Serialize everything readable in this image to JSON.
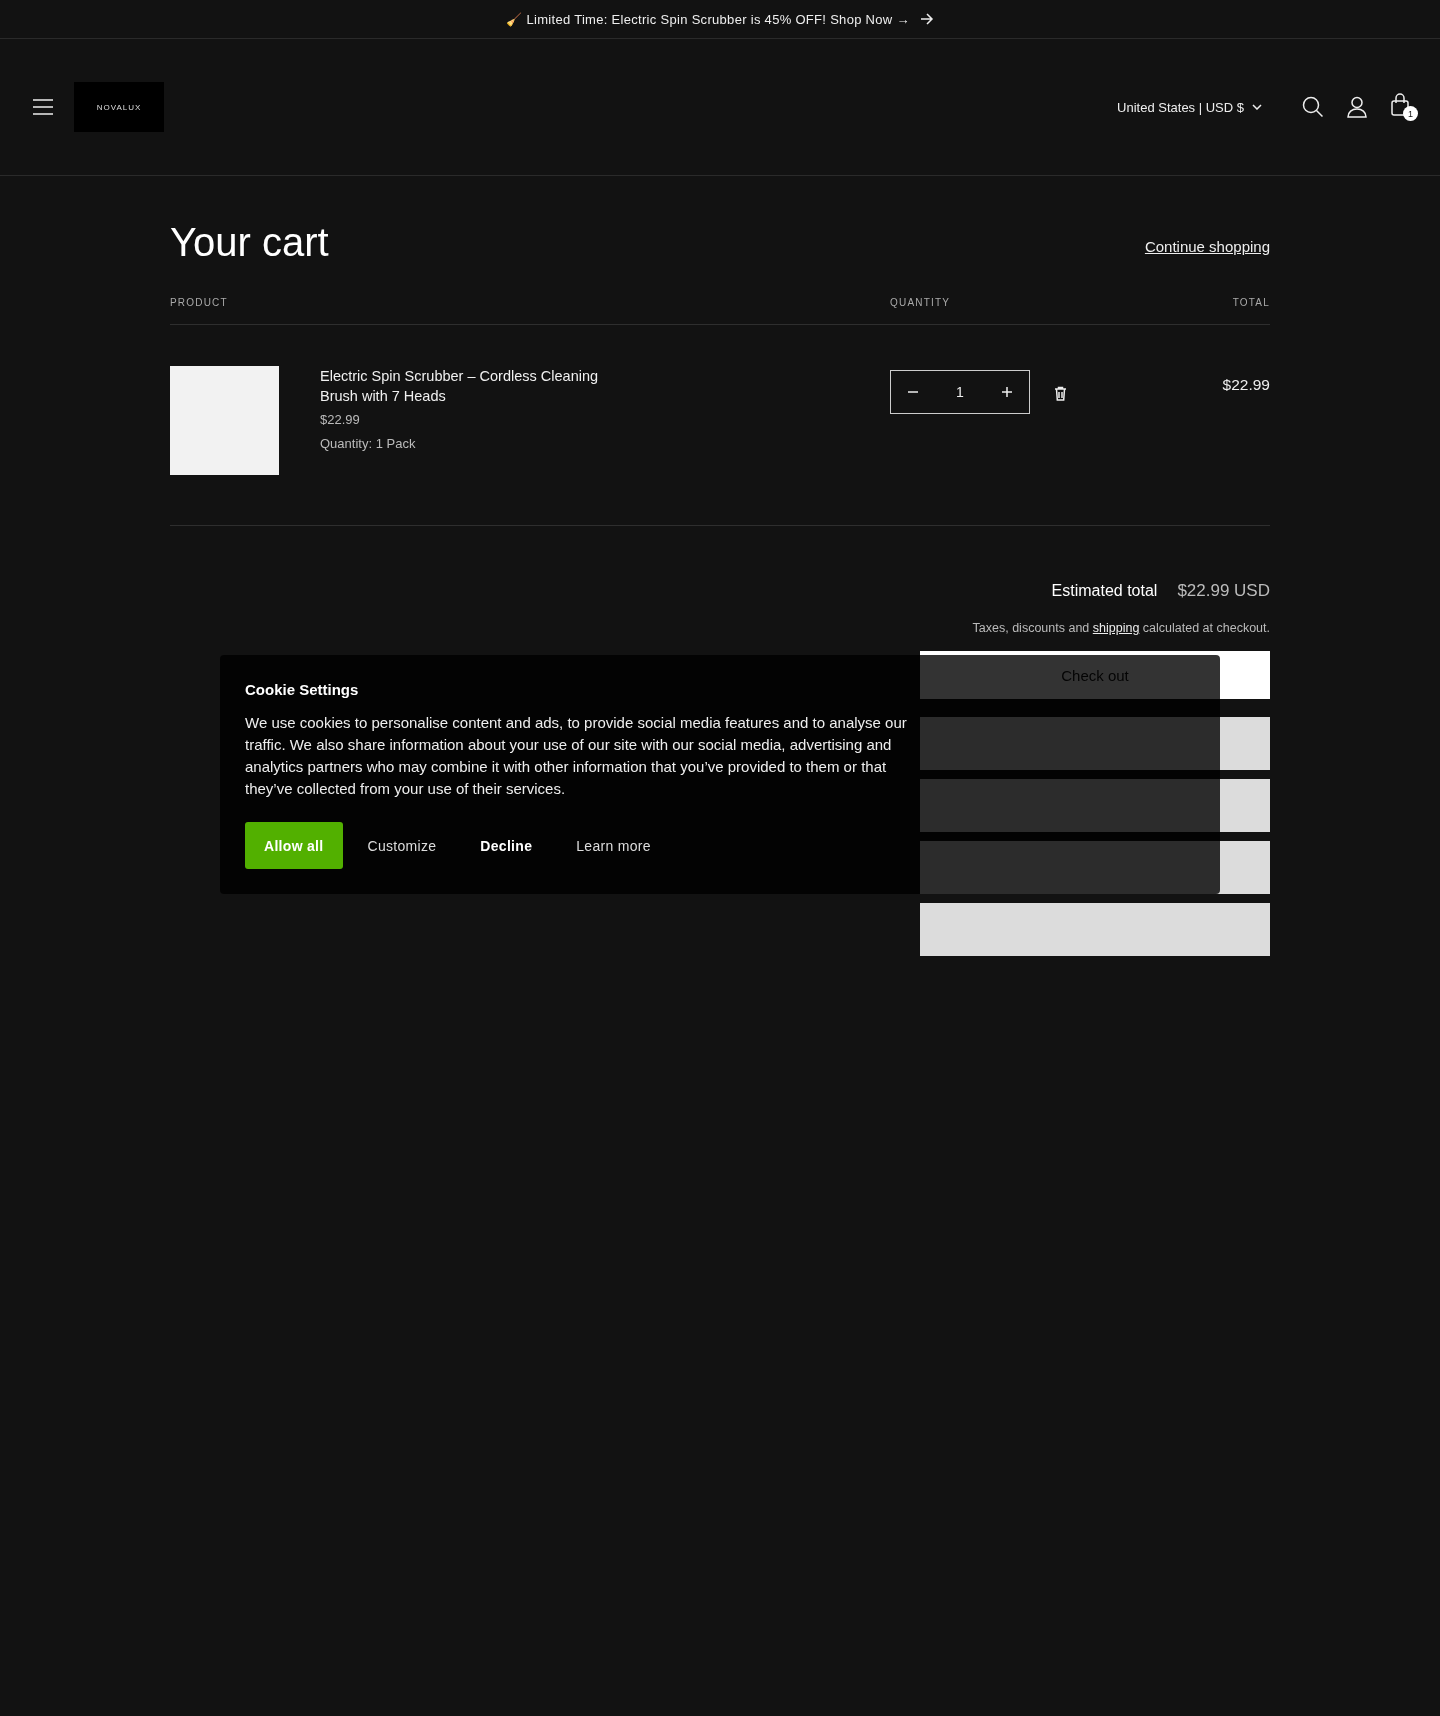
{
  "announcement": {
    "text": "🧹 Limited Time: Electric Spin Scrubber is 45% OFF! Shop Now →"
  },
  "header": {
    "logo": "NOVALUX",
    "country_selector": "United States | USD $",
    "cart_count": "1"
  },
  "cart": {
    "title": "Your cart",
    "continue_link": "Continue shopping",
    "columns": [
      "PRODUCT",
      "QUANTITY",
      "TOTAL"
    ],
    "items": [
      {
        "name": "Electric Spin Scrubber – Cordless Cleaning Brush with 7 Heads",
        "price": "$22.99",
        "option_label": "Quantity:",
        "option_value": "1 Pack",
        "quantity": "1",
        "total": "$22.99"
      }
    ],
    "estimated_total_label": "Estimated total",
    "estimated_total": "$22.99 USD",
    "tax_note_before": "Taxes, discounts and",
    "tax_note_link": "shipping",
    "tax_note_after": "calculated at checkout.",
    "checkout_button": "Check out"
  },
  "cookie_banner": {
    "title": "Cookie Settings",
    "body": "We use cookies to personalise content and ads, to provide social media features and to analyse our traffic. We also share information about your use of our site with our social media, advertising and analytics partners who may combine it with other information that you’ve provided to them or that they’ve collected from your use of their services.",
    "buttons": [
      {
        "label": "Allow all",
        "kind": "primary"
      },
      {
        "label": "Customize",
        "kind": "plain"
      },
      {
        "label": "Decline",
        "kind": "bold"
      },
      {
        "label": "Learn more",
        "kind": "plain"
      }
    ]
  }
}
